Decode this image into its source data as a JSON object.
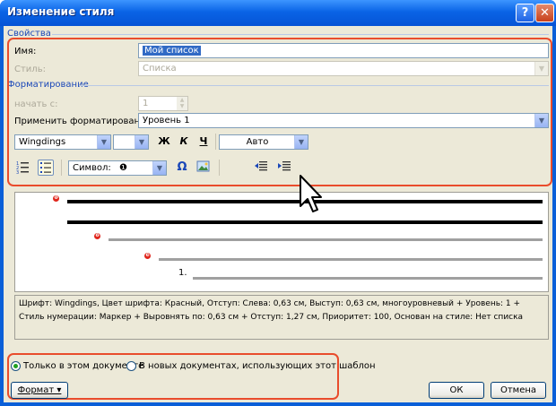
{
  "window": {
    "title": "Изменение стиля",
    "help_glyph": "?",
    "close_glyph": "✕"
  },
  "properties": {
    "section_label": "Свойства",
    "name_label": "Имя:",
    "name_value": "Мой список",
    "style_label": "Стиль:",
    "style_value": "Списка"
  },
  "formatting": {
    "section_label": "Форматирование",
    "start_label": "начать с:",
    "start_value": "1",
    "apply_label": "Применить форматирование к:",
    "apply_value": "Уровень 1",
    "font_name": "Wingdings",
    "font_size": "",
    "size_extra": "",
    "bold_glyph": "Ж",
    "italic_glyph": "К",
    "underline_glyph": "Ч",
    "color_value": "Авто",
    "symbol_label": "Символ:",
    "symbol_value": "❶",
    "omega_glyph": "Ω"
  },
  "preview": {
    "markers": [
      "❶",
      "❷",
      "❸",
      "1."
    ]
  },
  "description": "Шрифт: Wingdings, Цвет шрифта: Красный, Отступ: Слева:  0,63 см, Выступ:  0,63 см, многоуровневый + Уровень: 1 + Стиль нумерации: Маркер + Выровнять по:  0,63 см + Отступ:  1,27 см, Приоритет: 100, Основан на стиле: Нет списка",
  "scope": {
    "this_document": "Только в этом документе",
    "new_documents": "В новых документах, использующих этот шаблон"
  },
  "buttons": {
    "format": "Формат ▾",
    "ok": "ОК",
    "cancel": "Отмена"
  }
}
